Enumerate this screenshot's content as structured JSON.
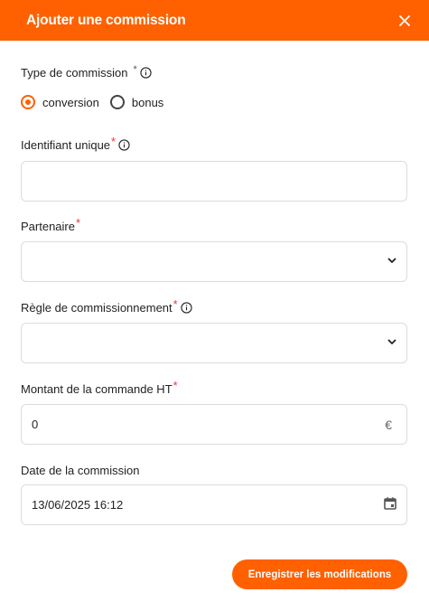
{
  "modal": {
    "title": "Ajouter une commission",
    "close_icon": "close-icon"
  },
  "type_commission": {
    "label": "Type de commission",
    "required_mark": "*",
    "options": [
      {
        "label": "conversion",
        "checked": true
      },
      {
        "label": "bonus",
        "checked": false
      }
    ]
  },
  "identifiant": {
    "label": "Identifiant unique",
    "required_mark": "*",
    "value": ""
  },
  "partenaire": {
    "label": "Partenaire",
    "required_mark": "*",
    "value": ""
  },
  "regle": {
    "label": "Règle de commissionnement",
    "required_mark": "*",
    "value": ""
  },
  "montant": {
    "label": "Montant de la commande HT",
    "required_mark": "*",
    "value": "0",
    "currency": "€"
  },
  "date": {
    "label": "Date de la commission",
    "value": "13/06/2025 16:12"
  },
  "actions": {
    "save_label": "Enregistrer les modifications"
  },
  "colors": {
    "accent": "#ff6000",
    "required": "#e53935"
  }
}
